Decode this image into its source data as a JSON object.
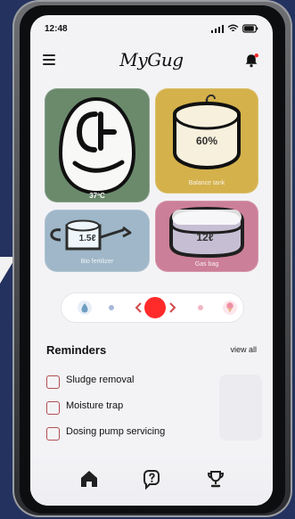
{
  "status_bar": {
    "time": "12:48"
  },
  "app": {
    "title": "MyGug"
  },
  "tiles": {
    "egg": {
      "temperature": "37ºC",
      "icon": "egg-face-icon",
      "color": "#6b8a6c"
    },
    "tank": {
      "value": "60%",
      "label": "Balance tank",
      "icon": "tank-icon",
      "color": "#d4b14b"
    },
    "bio": {
      "value": "1.5ℓ",
      "label": "Bio fertilizer",
      "icon": "watering-can-icon",
      "color": "#9fb7c8"
    },
    "gas": {
      "value": "12ℓ",
      "label": "Gas bag",
      "icon": "gas-bag-icon",
      "color": "#cc7f98"
    }
  },
  "reminders": {
    "title": "Reminders",
    "view_all": "view all",
    "items": [
      {
        "label": "Sludge removal",
        "checked": false
      },
      {
        "label": "Moisture trap",
        "checked": false
      },
      {
        "label": "Dosing pump servicing",
        "checked": false
      }
    ]
  },
  "nav": {
    "items": [
      {
        "icon": "home-icon"
      },
      {
        "icon": "help-icon"
      },
      {
        "icon": "trophy-icon"
      }
    ]
  },
  "colors": {
    "background": "#24325f",
    "accent_red": "#ff2b2b",
    "checkbox_border": "#b14f4f",
    "screen": "#f3f3f6"
  }
}
